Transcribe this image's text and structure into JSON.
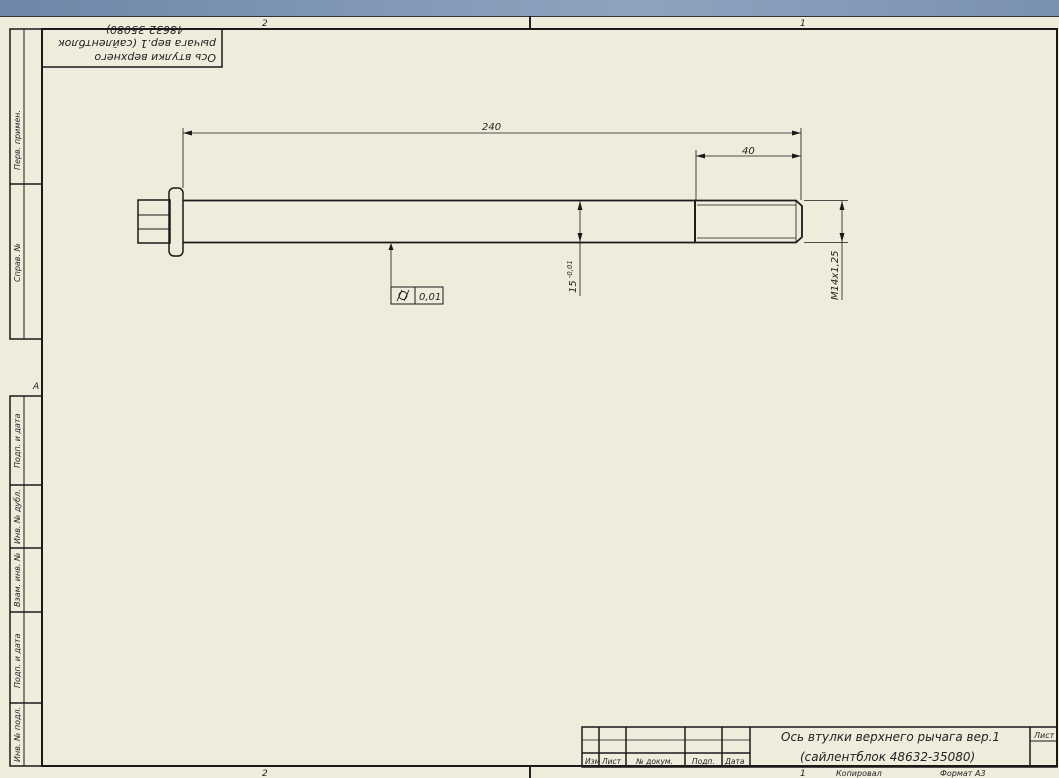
{
  "drawing": {
    "title_line1": "Ось втулки верхнего рычага вер.1",
    "title_line2": "(сайлентблок 48632-35080)",
    "mirror_line1": "Ось втулки верхнего",
    "mirror_line2": "рычага вер.1 (сайлентблок",
    "mirror_line3": "48632-35080)",
    "dims": {
      "overall": "240",
      "thread_len": "40",
      "diameter": "15",
      "diameter_tol": "-0,01",
      "thread": "M14x1,25",
      "tolerance_value": "0,01"
    },
    "zones": {
      "top_left": "2",
      "top_right": "1",
      "bottom_left": "2",
      "bottom_right": "1",
      "side": "A"
    },
    "side_stamp": {
      "perv_primen": "Перв. примен.",
      "sprav_no": "Справ. №",
      "podp_data_1": "Подп. и дата",
      "inv_dubl": "Инв. № дубл.",
      "vzam_inv": "Взам. инв. №",
      "podp_data_2": "Подп. и дата",
      "inv_podl": "Инв. № подл."
    },
    "title_block": {
      "izm": "Изм",
      "list": "Лист",
      "n_dokum": "№ докум.",
      "podp": "Подп.",
      "data": "Дата",
      "sheet_label": "Лист",
      "kopiroval": "Копировал",
      "format": "Формат А3"
    }
  },
  "colors": {
    "paper": "#efecdc",
    "line": "#1a1a1a",
    "bar": "#7a90b0"
  }
}
